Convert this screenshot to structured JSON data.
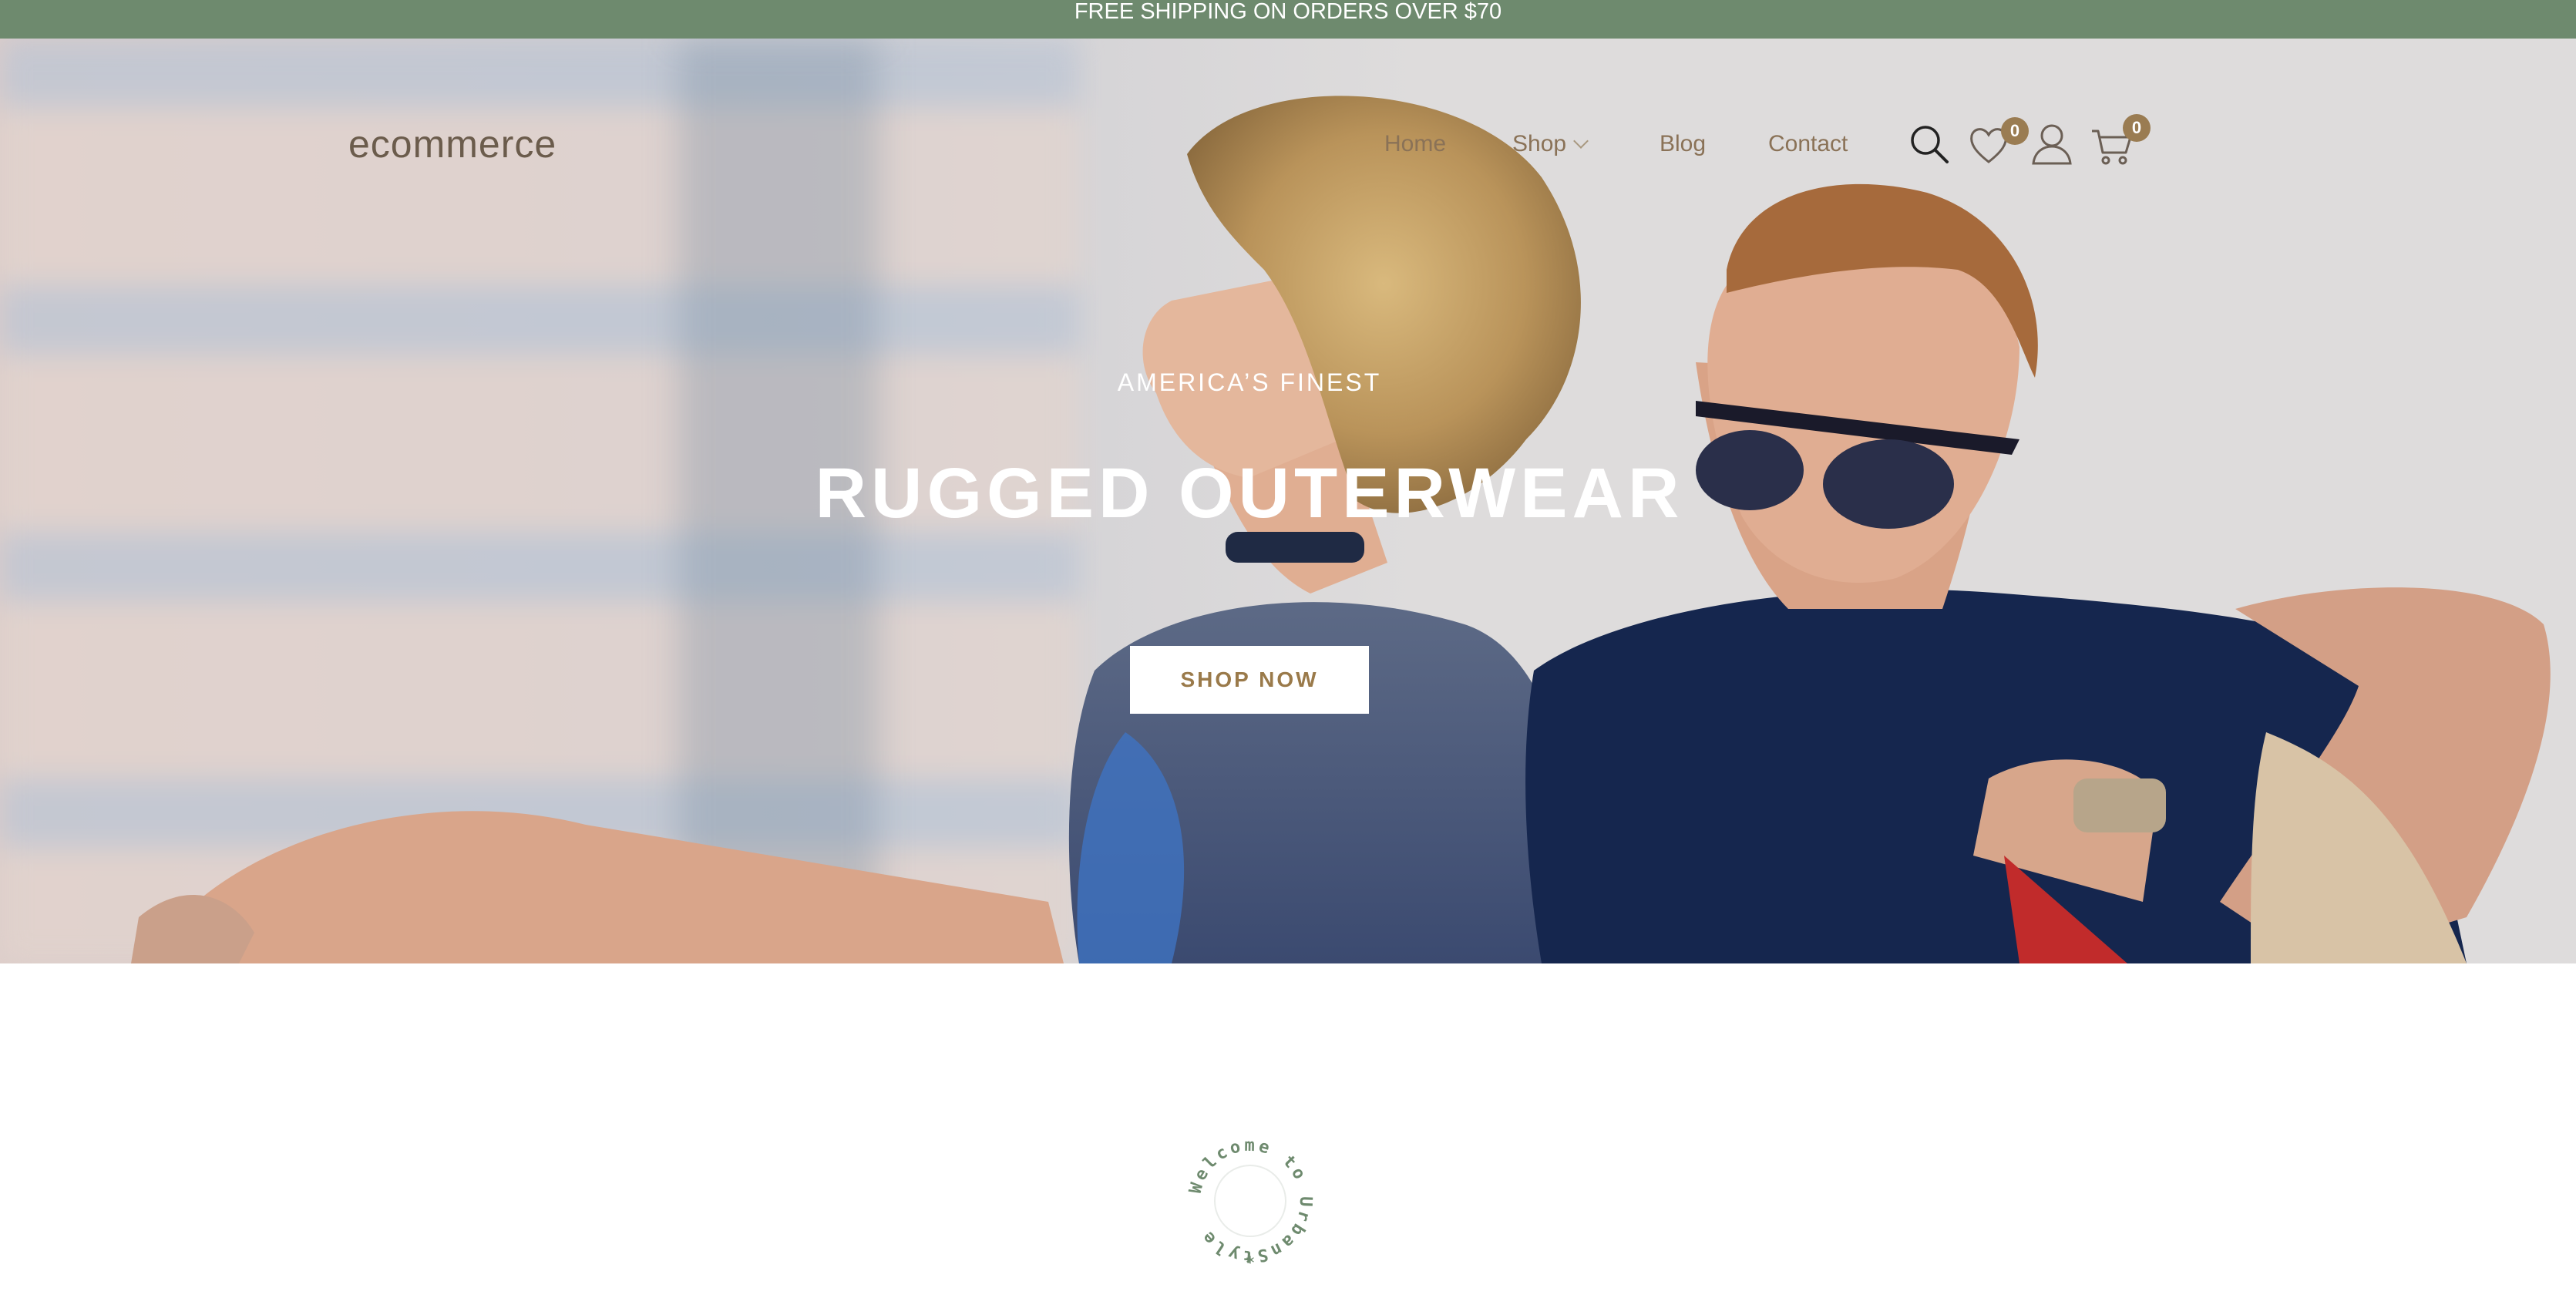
{
  "announcement": {
    "text": "FREE SHIPPING ON ORDERS OVER $70"
  },
  "header": {
    "logo": "ecommerce",
    "nav": [
      {
        "label": "Home"
      },
      {
        "label": "Shop",
        "has_dropdown": true
      },
      {
        "label": "Blog"
      },
      {
        "label": "Contact"
      }
    ],
    "icons": {
      "search": "search-icon",
      "wishlist": "heart-icon",
      "account": "user-icon",
      "cart": "cart-icon"
    },
    "wishlist_count": "0",
    "cart_count": "0"
  },
  "hero": {
    "eyebrow": "AMERICA’S FINEST",
    "headline": "RUGGED OUTERWEAR",
    "cta_label": "SHOP NOW"
  },
  "welcome_badge": {
    "text": "Welcome to UrbanStyle",
    "ornament": "*"
  },
  "colors": {
    "topbar": "#6e8a6e",
    "accent": "#9a7c52",
    "nav_text": "#8a7257",
    "badge_text": "#6e8a6e"
  }
}
